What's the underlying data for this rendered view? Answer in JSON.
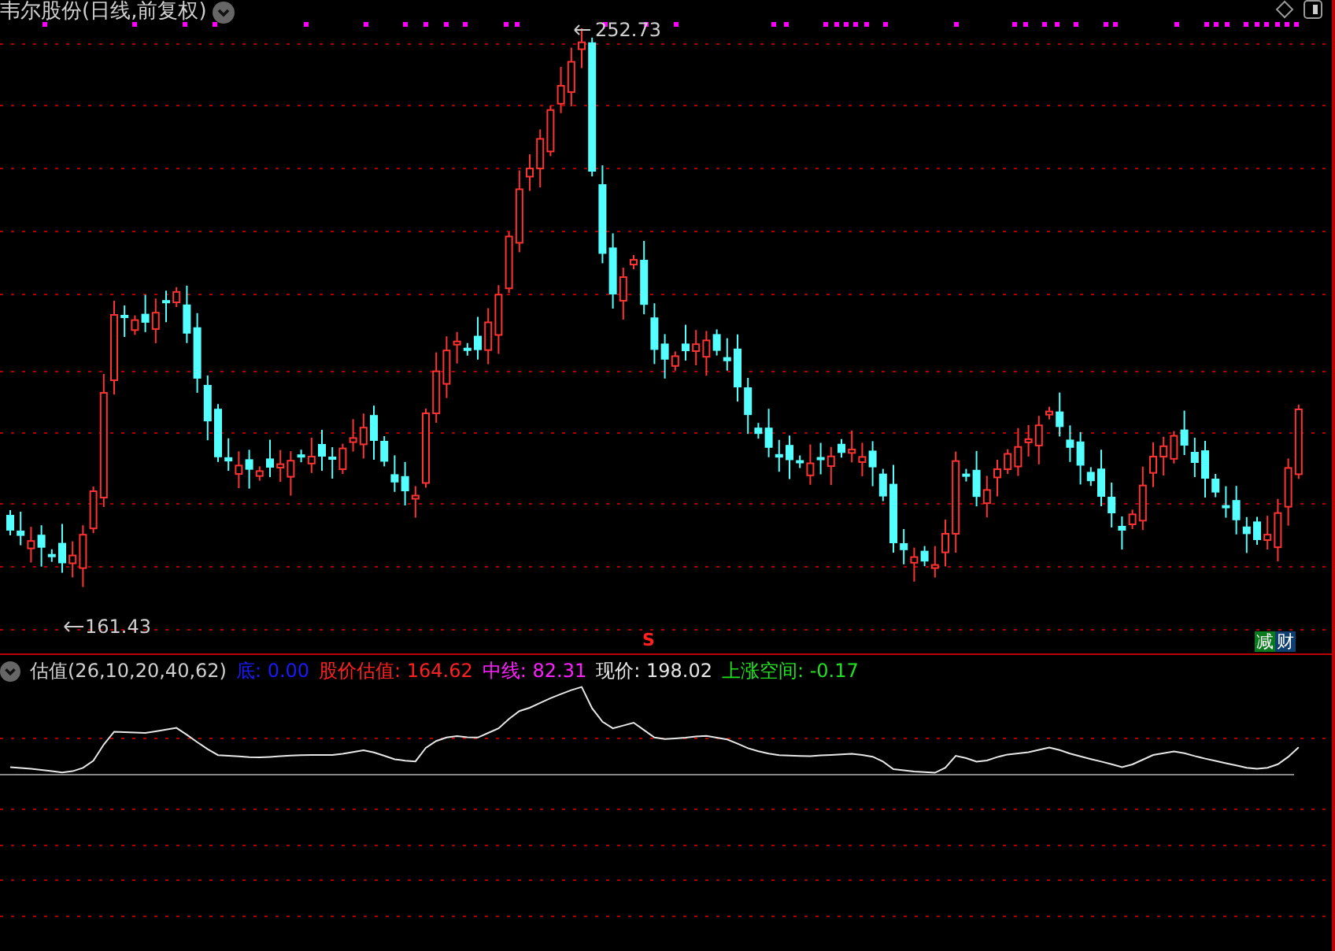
{
  "main_chart": {
    "title": "韦尔股份(日线,前复权)",
    "high_label": "252.73",
    "low_label": "161.43",
    "signal_mark": "S",
    "badges": [
      {
        "text": "减",
        "color": "#0a7a1e"
      },
      {
        "text": "财",
        "color": "#0f3f6e"
      }
    ]
  },
  "indicator": {
    "title": "估值(26,10,20,40,62)",
    "readings": [
      {
        "label": "底:",
        "value": "0.00",
        "color": "#1a1aff"
      },
      {
        "label": "股价估值:",
        "value": "164.62",
        "color": "#ff2020"
      },
      {
        "label": "中线:",
        "value": "82.31",
        "color": "#ff20ff"
      },
      {
        "label": "现价:",
        "value": "198.02",
        "color": "#e6e6e6"
      },
      {
        "label": "上涨空间:",
        "value": "-0.17",
        "color": "#20e020"
      }
    ]
  }
}
